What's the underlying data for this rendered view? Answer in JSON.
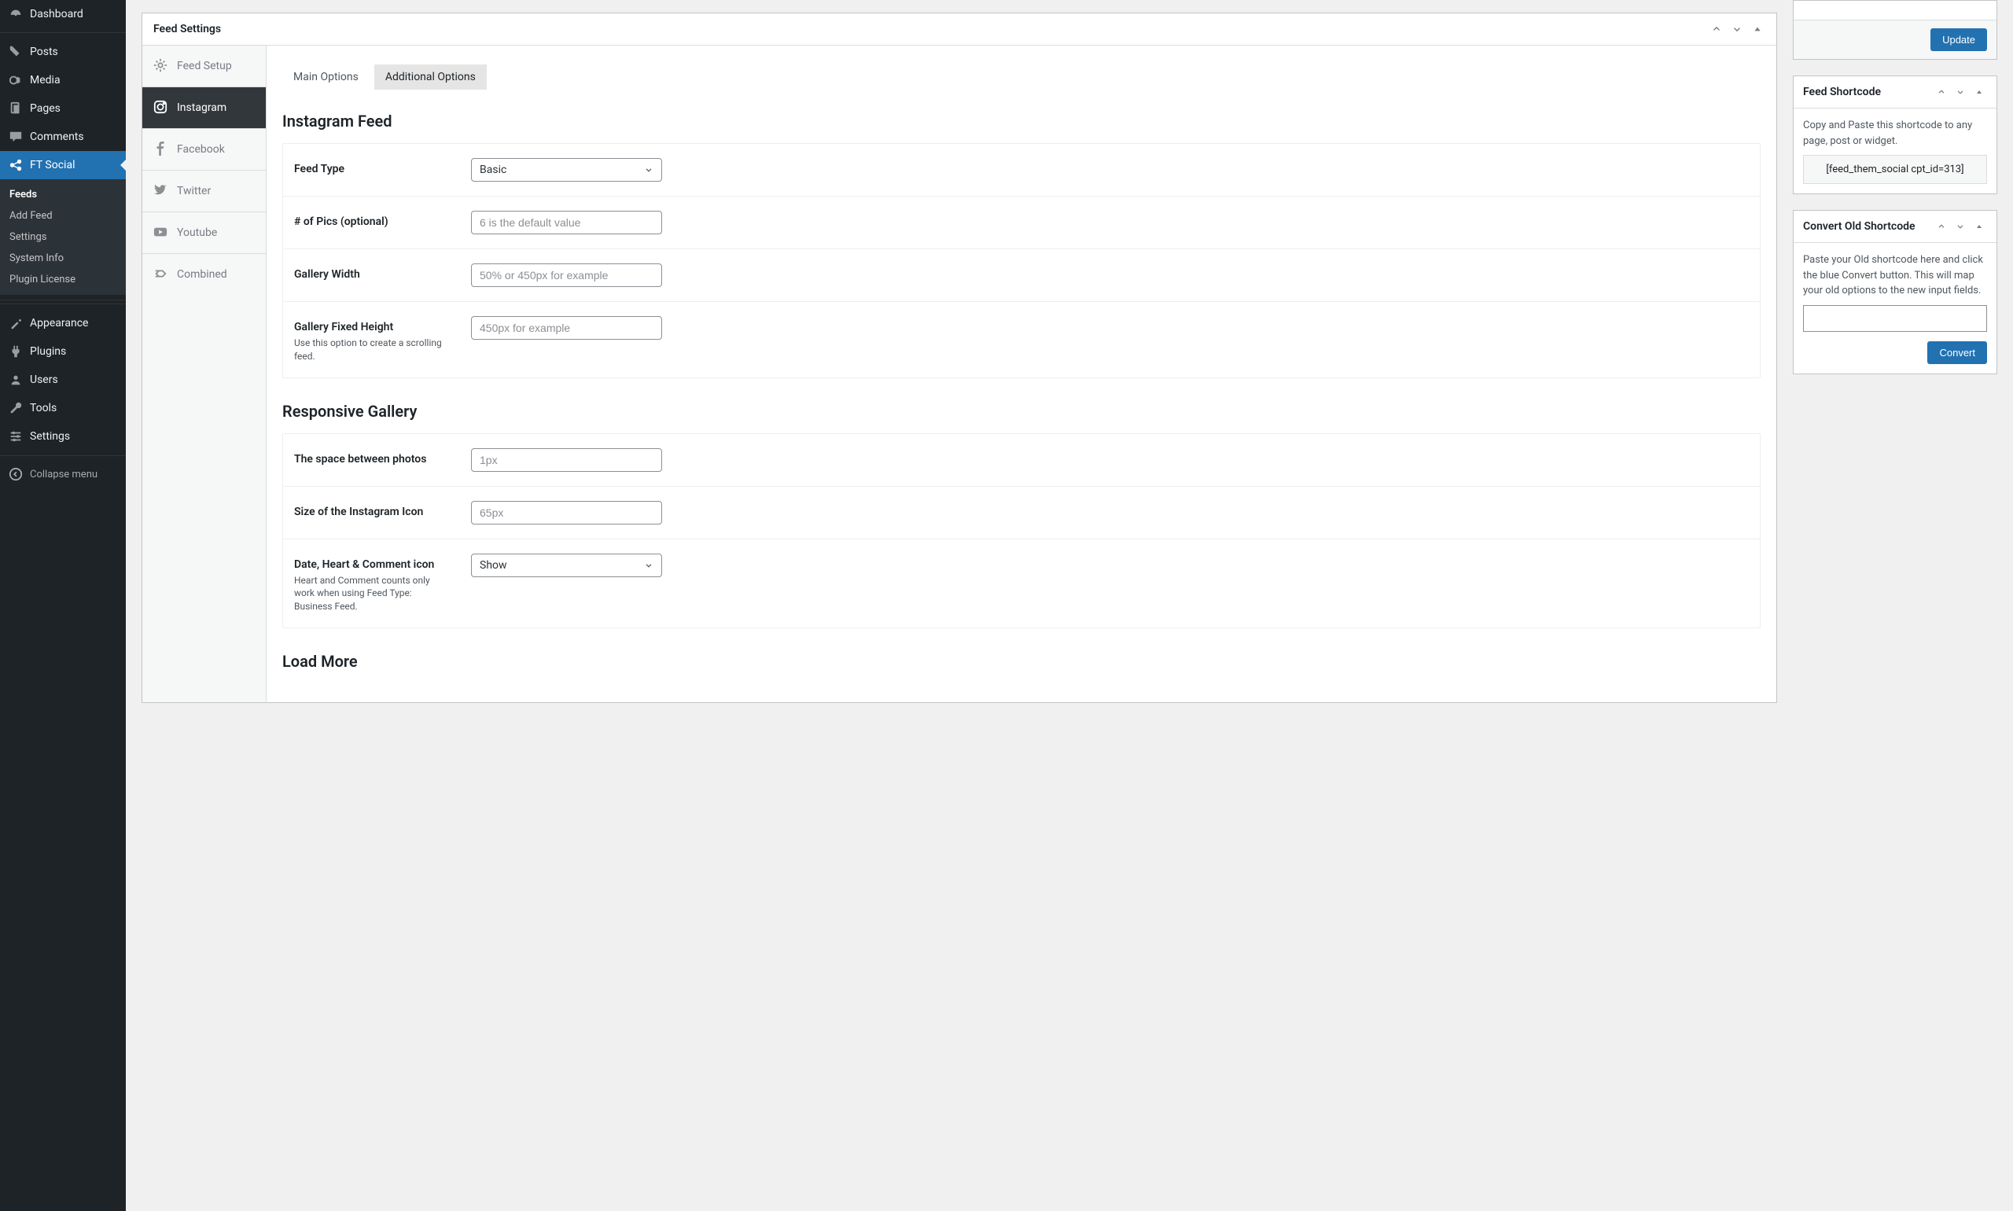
{
  "adminMenu": {
    "items": [
      {
        "label": "Dashboard",
        "icon": "speedometer"
      },
      {
        "label": "Posts",
        "icon": "pin"
      },
      {
        "label": "Media",
        "icon": "media"
      },
      {
        "label": "Pages",
        "icon": "pages"
      },
      {
        "label": "Comments",
        "icon": "comment"
      },
      {
        "label": "FT Social",
        "icon": "share",
        "active": true
      },
      {
        "label": "Appearance",
        "icon": "brush"
      },
      {
        "label": "Plugins",
        "icon": "plug"
      },
      {
        "label": "Users",
        "icon": "user"
      },
      {
        "label": "Tools",
        "icon": "wrench"
      },
      {
        "label": "Settings",
        "icon": "sliders"
      }
    ],
    "submenu": [
      {
        "label": "Feeds",
        "current": true
      },
      {
        "label": "Add Feed"
      },
      {
        "label": "Settings"
      },
      {
        "label": "System Info"
      },
      {
        "label": "Plugin License"
      }
    ],
    "collapse": "Collapse menu"
  },
  "panel": {
    "title": "Feed Settings"
  },
  "feedNav": [
    {
      "label": "Feed Setup",
      "icon": "gear"
    },
    {
      "label": "Instagram",
      "icon": "instagram",
      "active": true
    },
    {
      "label": "Facebook",
      "icon": "facebook"
    },
    {
      "label": "Twitter",
      "icon": "twitter"
    },
    {
      "label": "Youtube",
      "icon": "youtube"
    },
    {
      "label": "Combined",
      "icon": "combined"
    }
  ],
  "tabs": {
    "main": "Main Options",
    "add": "Additional Options"
  },
  "sections": {
    "s1": "Instagram Feed",
    "s2": "Responsive Gallery",
    "s3": "Load More"
  },
  "fields": {
    "feedType": {
      "label": "Feed Type",
      "value": "Basic"
    },
    "pics": {
      "label": "# of Pics (optional)",
      "placeholder": "6 is the default value"
    },
    "galWidth": {
      "label": "Gallery Width",
      "placeholder": "50% or 450px for example"
    },
    "galHeight": {
      "label": "Gallery Fixed Height",
      "hint": "Use this option to create a scrolling feed.",
      "placeholder": "450px for example"
    },
    "space": {
      "label": "The space between photos",
      "placeholder": "1px"
    },
    "iconSize": {
      "label": "Size of the Instagram Icon",
      "placeholder": "65px"
    },
    "dhc": {
      "label": "Date, Heart & Comment icon",
      "hint": "Heart and Comment counts only work when using Feed Type: Business Feed.",
      "value": "Show"
    }
  },
  "sidebar": {
    "update": {
      "button": "Update"
    },
    "shortcode": {
      "title": "Feed Shortcode",
      "desc": "Copy and Paste this shortcode to any page, post or widget.",
      "code": "[feed_them_social cpt_id=313]"
    },
    "convert": {
      "title": "Convert Old Shortcode",
      "desc": "Paste your Old shortcode here and click the blue Convert button. This will map your old options to the new input fields.",
      "button": "Convert"
    }
  }
}
